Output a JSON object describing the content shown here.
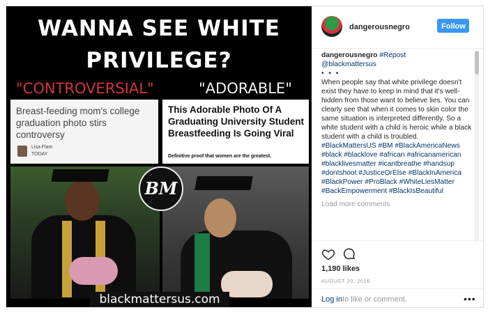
{
  "post": {
    "image": {
      "headline_line1": "WANNA SEE WHITE",
      "headline_line2": "PRIVILEGE?",
      "label_left": "\"CONTROVERSIAL\"",
      "label_right": "\"ADORABLE\"",
      "news_left": {
        "title": "Breast-feeding mom's college graduation photo stirs controversy",
        "author": "Lisa Flam",
        "source": "TODAY"
      },
      "news_right": {
        "title": "This Adorable Photo Of A Graduating University Student Breastfeeding Is Going Viral",
        "subtitle": "Definitive proof that women are the greatest."
      },
      "logo_text": "BM",
      "watermark": "blackmattersus.com"
    },
    "header": {
      "username": "dangerousnegro",
      "follow_label": "Follow"
    },
    "caption": {
      "username": "dangerousnegro",
      "repost_tag": "#Repost",
      "mention": "@blackmattersus",
      "dots": "• • •",
      "text": "When people say that white privilege doesn't exist they have to keep in mind that it's well-hidden from those want to believe lies. You can clearly see that when it comes to skin color the same situation is interpreted differently. So a white student with a child is heroic while a black student with a child is troubled.",
      "hashtags": [
        "#BlackMattersUS",
        "#BM",
        "#BlackAmericaNews",
        "#black",
        "#blacklove",
        "#african",
        "#africanamerican",
        "#blacklivesmatter",
        "#icantbreathe",
        "#handsup",
        "#dontshoot",
        "#JusticeOrElse",
        "#BlackInAmerica",
        "#BlackPower",
        "#ProBlack",
        "#WhiteLiesMatter",
        "#BackEmpowerment",
        "#BlackIsBeautiful"
      ],
      "load_more": "Load more comments"
    },
    "likes": "1,190 likes",
    "date": "AUGUST 20, 2016",
    "login_link": "Log in",
    "login_rest": "to like or comment.",
    "more_label": "•••"
  },
  "colors": {
    "accent": "#3897f0",
    "link": "#003569",
    "controversial_red": "#d6343a"
  }
}
